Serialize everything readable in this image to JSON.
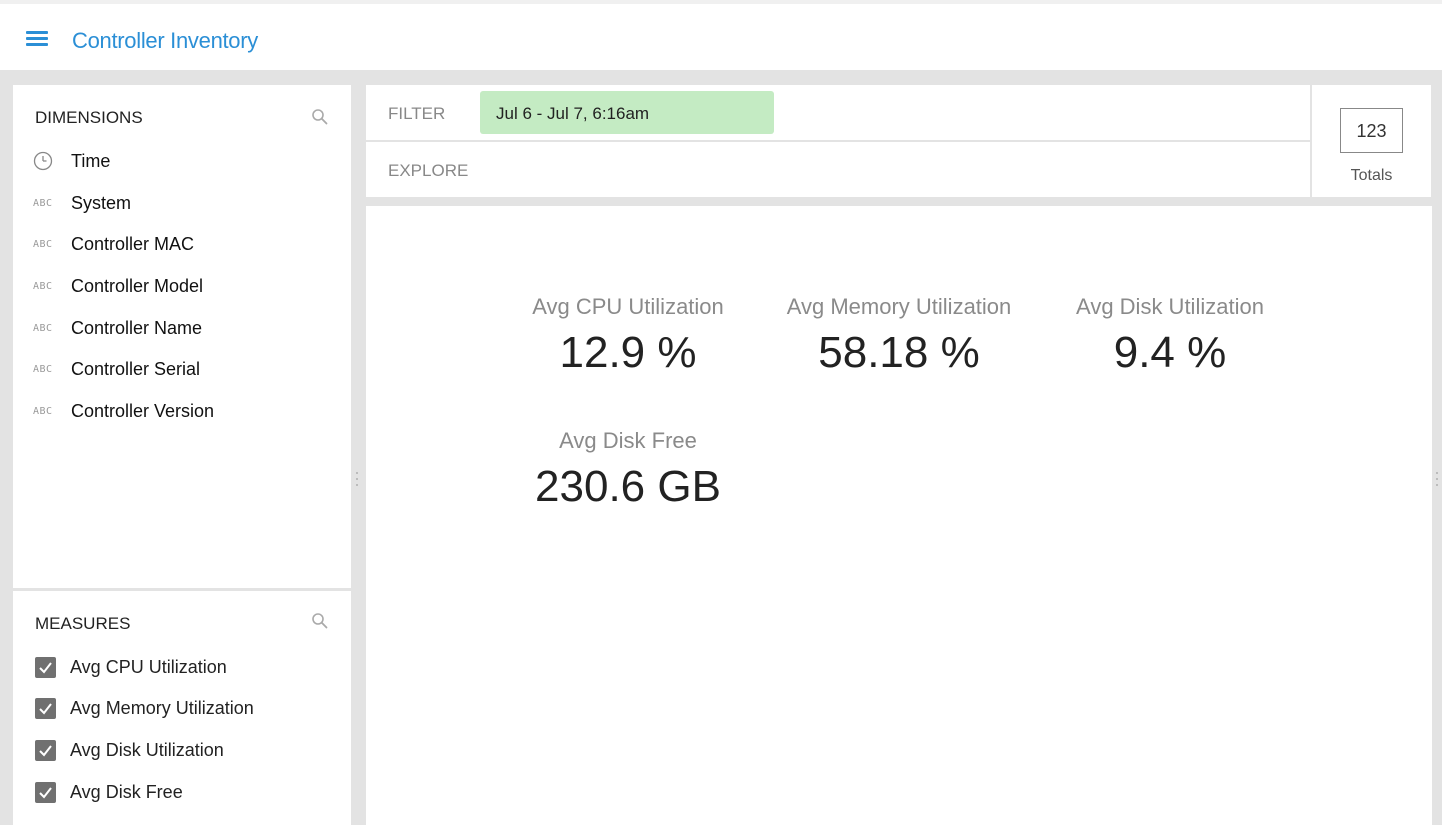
{
  "app": {
    "title": "Controller Inventory"
  },
  "dimensions": {
    "header": "DIMENSIONS",
    "items": [
      {
        "label": "Time",
        "icon": "clock-icon"
      },
      {
        "label": "System",
        "icon": "abc-icon"
      },
      {
        "label": "Controller MAC",
        "icon": "abc-icon"
      },
      {
        "label": "Controller Model",
        "icon": "abc-icon"
      },
      {
        "label": "Controller Name",
        "icon": "abc-icon"
      },
      {
        "label": "Controller Serial",
        "icon": "abc-icon"
      },
      {
        "label": "Controller Version",
        "icon": "abc-icon"
      }
    ],
    "abc_glyph": "ABC"
  },
  "measures": {
    "header": "MEASURES",
    "items": [
      {
        "label": "Avg CPU Utilization",
        "checked": true
      },
      {
        "label": "Avg Memory Utilization",
        "checked": true
      },
      {
        "label": "Avg Disk Utilization",
        "checked": true
      },
      {
        "label": "Avg Disk Free",
        "checked": true
      }
    ]
  },
  "filter": {
    "label": "FILTER",
    "chip": "Jul 6 - Jul 7, 6:16am"
  },
  "explore": {
    "label": "EXPLORE"
  },
  "totals": {
    "icon_text": "123",
    "label": "Totals"
  },
  "metrics": [
    {
      "label": "Avg CPU Utilization",
      "value": "12.9 %"
    },
    {
      "label": "Avg Memory Utilization",
      "value": "58.18 %"
    },
    {
      "label": "Avg Disk Utilization",
      "value": "9.4 %"
    },
    {
      "label": "Avg Disk Free",
      "value": "230.6 GB"
    }
  ],
  "colors": {
    "accent": "#2b8fd6",
    "filter_chip": "#c4ebc3",
    "checkbox": "#707070",
    "workspace_bg": "#e3e3e3"
  }
}
